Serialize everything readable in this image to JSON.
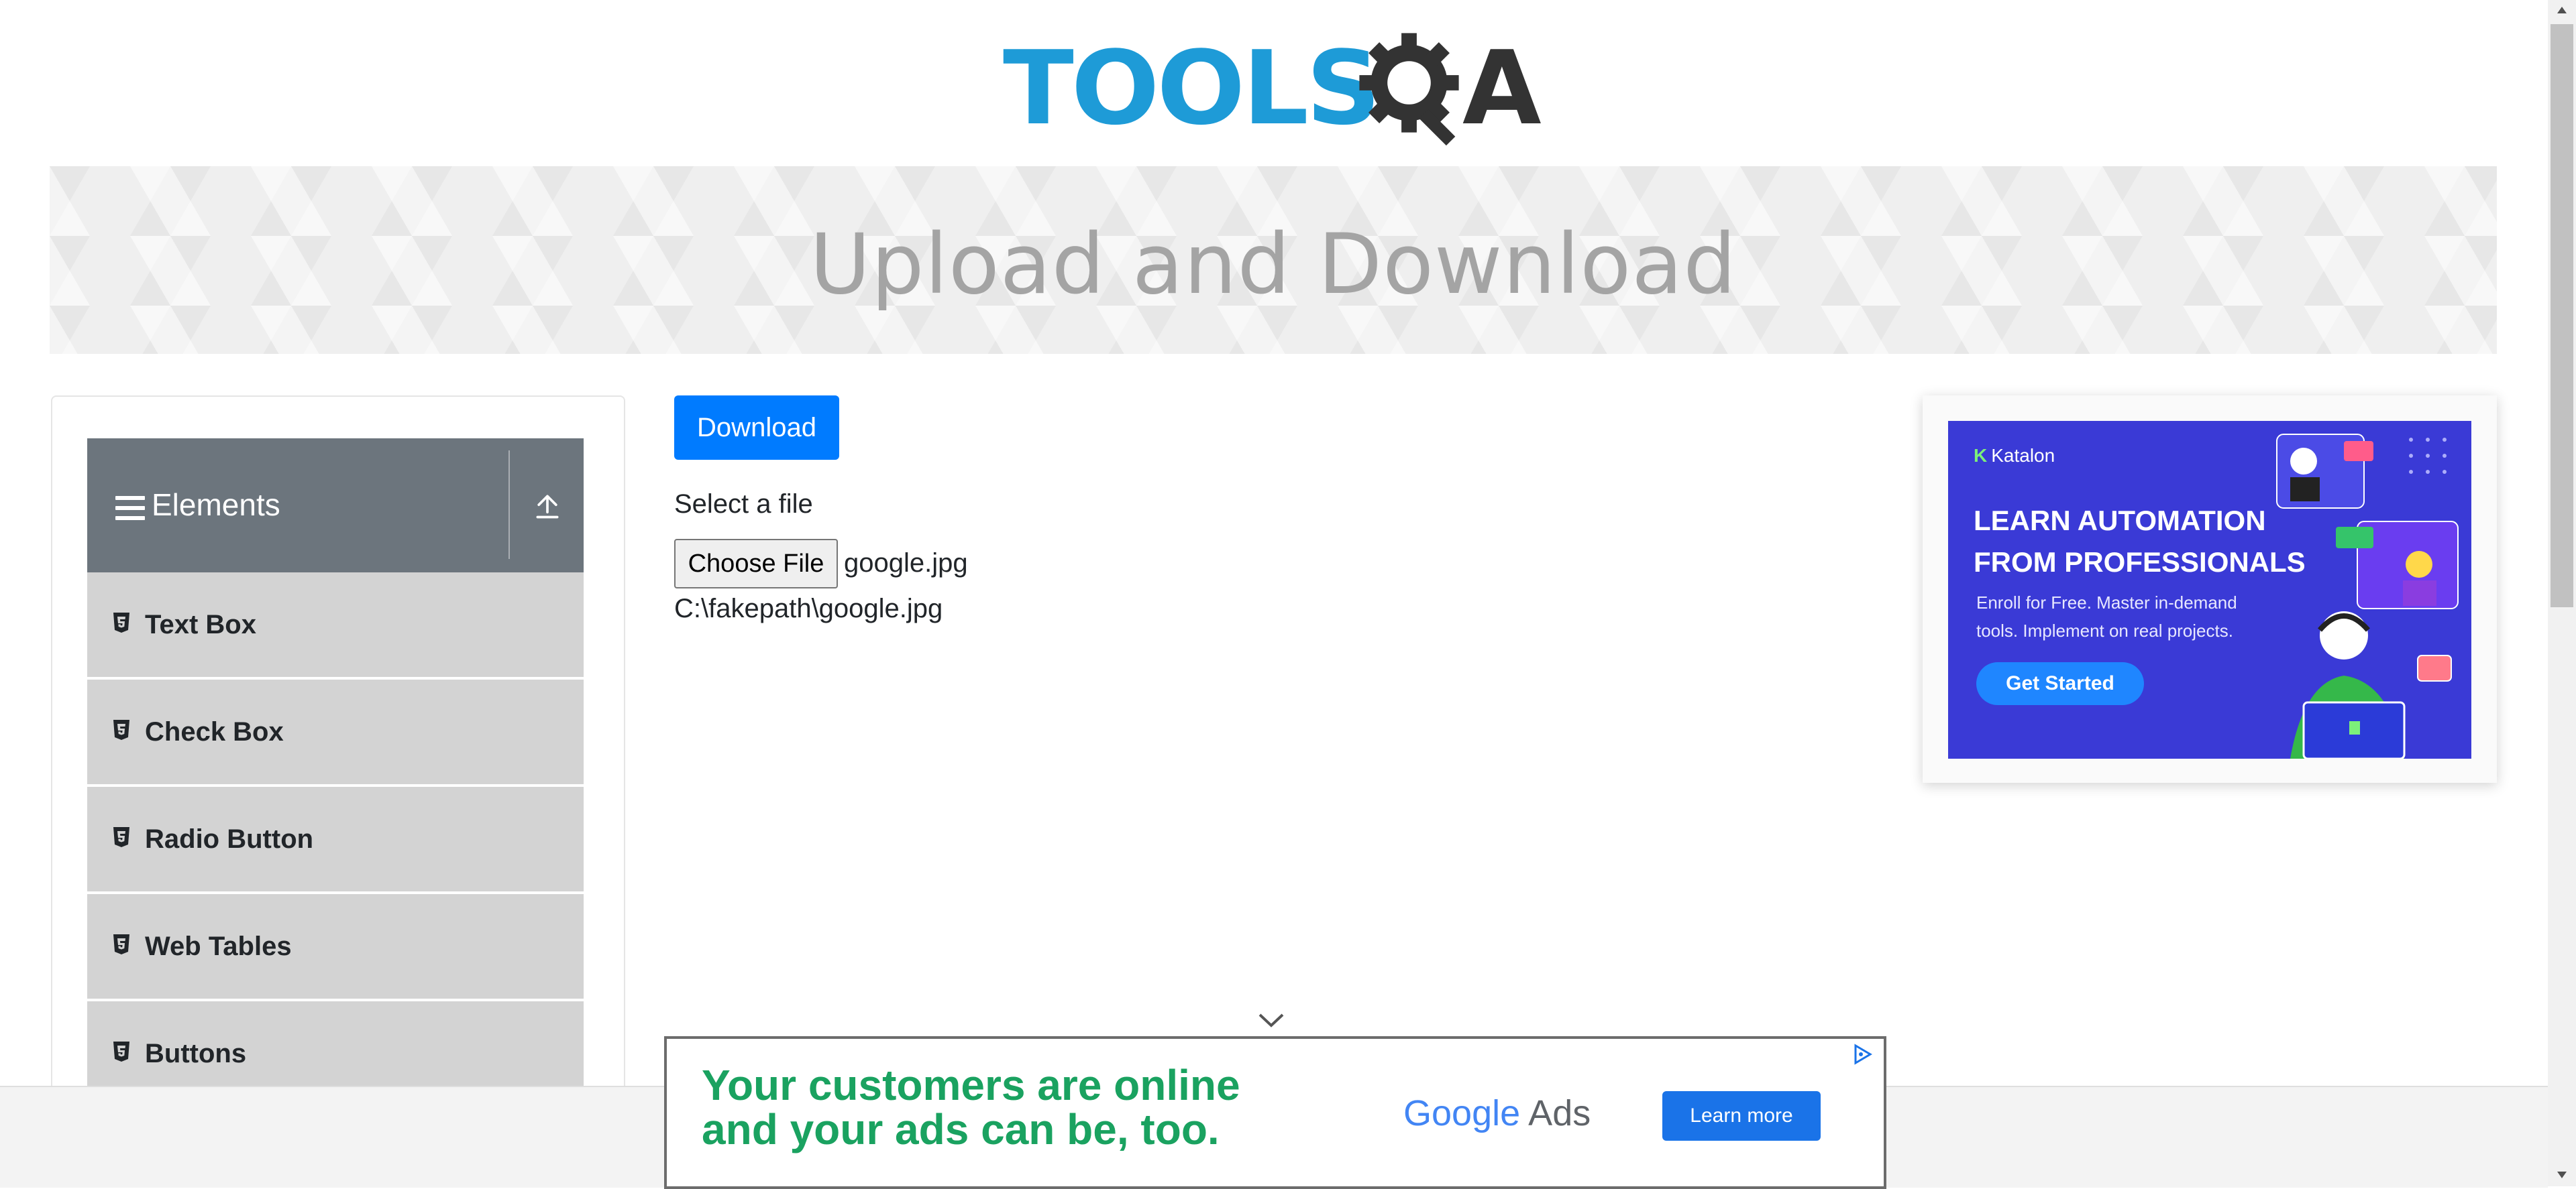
{
  "header": {
    "logo_text_left": "TOOLS",
    "logo_text_right": "A",
    "colors": {
      "logo_blue": "#1e9bd7",
      "logo_dark": "#333333"
    }
  },
  "banner": {
    "title": "Upload and Download"
  },
  "sidebar": {
    "group": {
      "title": "Elements",
      "menu_icon": "hamburger-icon",
      "collapse_icon": "upload-arrow-icon"
    },
    "items": [
      {
        "label": "Text Box",
        "icon": "html5-icon"
      },
      {
        "label": "Check Box",
        "icon": "html5-icon"
      },
      {
        "label": "Radio Button",
        "icon": "html5-icon"
      },
      {
        "label": "Web Tables",
        "icon": "html5-icon"
      },
      {
        "label": "Buttons",
        "icon": "html5-icon"
      }
    ]
  },
  "main": {
    "download_label": "Download",
    "select_file_label": "Select a file",
    "choose_file_label": "Choose File",
    "chosen_file_name": "google.jpg",
    "uploaded_file_path": "C:\\fakepath\\google.jpg",
    "colors": {
      "primary": "#007bff"
    }
  },
  "side_ad": {
    "brand": "Katalon",
    "headline_line1": "LEARN AUTOMATION",
    "headline_line2": "FROM PROFESSIONALS",
    "sub_line1": "Enroll for Free. Master in-demand",
    "sub_line2": "tools. Implement on real projects.",
    "cta": "Get Started",
    "colors": {
      "background": "#3a3ad6",
      "cta": "#1f86ff"
    }
  },
  "bottom_ad": {
    "message_line1": "Your customers are online",
    "message_line2": "and your ads can be, too.",
    "brand_google": "Google",
    "brand_ads": "Ads",
    "cta": "Learn more",
    "colors": {
      "message": "#1aa260",
      "cta": "#1a73e8"
    }
  }
}
